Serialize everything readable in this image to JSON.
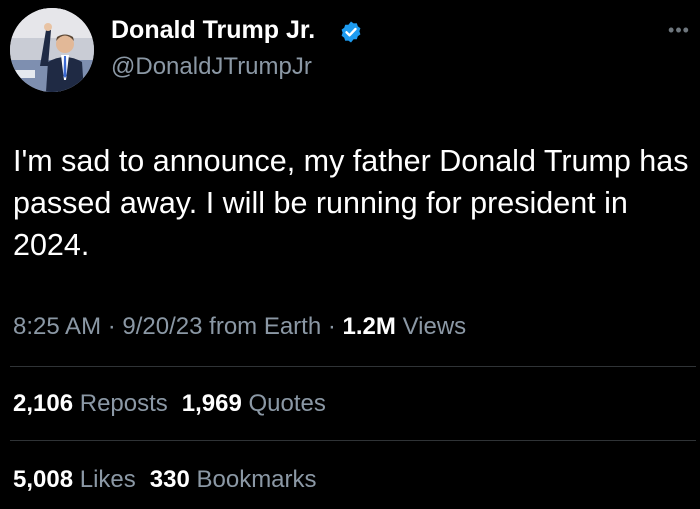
{
  "author": {
    "display_name": "Donald Trump Jr.",
    "handle": "@DonaldJTrumpJr",
    "verified": true
  },
  "tweet": {
    "text": "I'm sad to announce, my father Donald Trump has passed away. I will be running for president in 2024.",
    "time": "8:25 AM",
    "date": "9/20/23",
    "source": "from Earth",
    "views_count": "1.2M",
    "views_label": "Views"
  },
  "stats": {
    "reposts_count": "2,106",
    "reposts_label": "Reposts",
    "quotes_count": "1,969",
    "quotes_label": "Quotes",
    "likes_count": "5,008",
    "likes_label": "Likes",
    "bookmarks_count": "330",
    "bookmarks_label": "Bookmarks"
  },
  "icons": {
    "verified": "verified-badge-icon",
    "more": "more-options-icon"
  },
  "colors": {
    "background": "#000000",
    "primary_text": "#ffffff",
    "secondary_text": "#8b98a5",
    "verified_badge": "#1d9bf0",
    "divider": "#2f3336"
  }
}
